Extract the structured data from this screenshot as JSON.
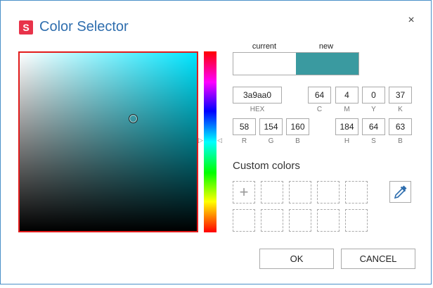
{
  "window": {
    "title": "Color Selector",
    "logo_letter": "S",
    "close_glyph": "×"
  },
  "colors": {
    "current": "#ffffff",
    "new": "#3a9aa0",
    "sv_hue": "#00e5ff",
    "picker_border": "#e21b1b",
    "accent_title": "#2f6eae",
    "logo_bg": "#e8334a"
  },
  "swatches": {
    "current_label": "current",
    "new_label": "new"
  },
  "hex": {
    "value": "3a9aa0",
    "label": "HEX"
  },
  "cmyk": [
    {
      "label": "C",
      "value": "64"
    },
    {
      "label": "M",
      "value": "4"
    },
    {
      "label": "Y",
      "value": "0"
    },
    {
      "label": "K",
      "value": "37"
    }
  ],
  "rgb": [
    {
      "label": "R",
      "value": "58"
    },
    {
      "label": "G",
      "value": "154"
    },
    {
      "label": "B",
      "value": "160"
    }
  ],
  "hsb": [
    {
      "label": "H",
      "value": "184"
    },
    {
      "label": "S",
      "value": "64"
    },
    {
      "label": "B",
      "value": "63"
    }
  ],
  "custom_colors": {
    "title": "Custom colors",
    "add_glyph": "+"
  },
  "icons": {
    "logo": "app-logo-icon",
    "close": "close-icon",
    "add": "plus-icon",
    "eyedropper": "eyedropper-icon",
    "hue_marker": "triangle-marker-icon"
  },
  "buttons": {
    "ok": "OK",
    "cancel": "CANCEL"
  }
}
